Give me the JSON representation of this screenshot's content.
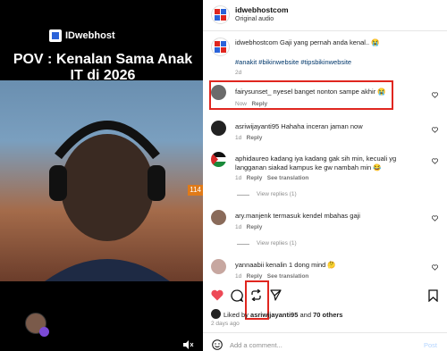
{
  "video": {
    "brand": "IDwebhost",
    "caption": "POV : Kenalan Sama Anak IT di 2026",
    "badge": "114"
  },
  "header": {
    "username": "idwebhostcom",
    "subtitle": "Original audio"
  },
  "post": {
    "caption_user": "idwebhostcom",
    "caption_text": "Gaji yang pernah anda kenal.. 😭",
    "hashtags": "#anakit #bikinwebsite #tipsbikinwebsite",
    "age": "2d"
  },
  "comments": [
    {
      "user": "fairysunset_",
      "text": "nyesel banget nonton sampe akhir 😭",
      "time": "Now",
      "reply": "Reply",
      "avatar_color": "#6b6b6b"
    },
    {
      "user": "asriwijayanti95",
      "text": "Hahaha inceran jaman now",
      "time": "1d",
      "reply": "Reply",
      "avatar_color": "#222222"
    },
    {
      "user": "aphidaureo",
      "text": "kadang iya kadang gak sih min, kecuali yg",
      "text2": "langganan siakad kampus ke gw nambah min 😂",
      "time": "1d",
      "reply": "Reply",
      "translate": "See translation",
      "view_replies": "View replies (1)"
    },
    {
      "user": "ary.manjenk",
      "text": "termasuk kendel mbahas gaji",
      "time": "1d",
      "reply": "Reply",
      "view_replies": "View replies (1)",
      "avatar_color": "#8a6b5a"
    },
    {
      "user": "yannaabii",
      "text": "kenalin 1 dong mind 🤔",
      "time": "1d",
      "reply": "Reply",
      "translate": "See translation",
      "avatar_color": "#c7a7a0"
    }
  ],
  "actions": {
    "liked_prefix": "Liked by",
    "liked_user": "asriwijayanti95",
    "liked_and": "and",
    "liked_others": "70 others",
    "age": "2 days ago"
  },
  "composer": {
    "placeholder": "Add a comment...",
    "post_label": "Post"
  },
  "colors": {
    "heart": "#ed4956",
    "highlight": "#e0261f",
    "link": "#00376b"
  }
}
